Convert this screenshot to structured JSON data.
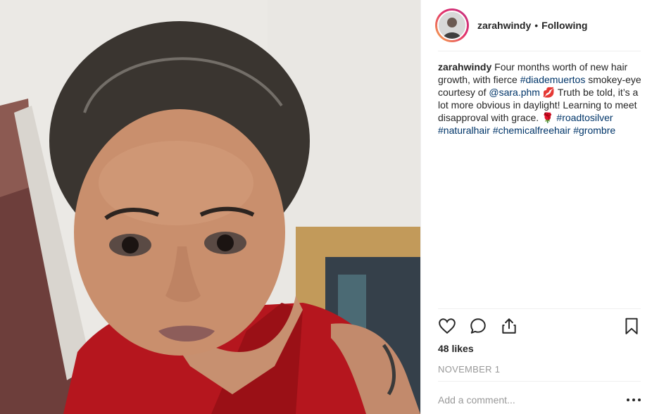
{
  "post": {
    "author": {
      "username": "zarahwindy",
      "follow_state": "Following",
      "separator": "•"
    },
    "caption": {
      "username": "zarahwindy",
      "segments": [
        {
          "type": "text",
          "value": " Four months worth of new hair growth, with fierce "
        },
        {
          "type": "link",
          "value": "#diademuertos"
        },
        {
          "type": "text",
          "value": " smokey-eye courtesy of "
        },
        {
          "type": "link",
          "value": "@sara.phm"
        },
        {
          "type": "text",
          "value": " 💋 Truth be told, it’s a lot more obvious in daylight! Learning to meet disapproval with grace. 🌹 "
        },
        {
          "type": "link",
          "value": "#roadtosilver"
        },
        {
          "type": "text",
          "value": " "
        },
        {
          "type": "link",
          "value": "#naturalhair"
        },
        {
          "type": "text",
          "value": " "
        },
        {
          "type": "link",
          "value": "#chemicalfreehair"
        },
        {
          "type": "text",
          "value": " "
        },
        {
          "type": "link",
          "value": "#grombre"
        }
      ]
    },
    "actions": {
      "like_icon": "heart-icon",
      "comment_icon": "comment-bubble-icon",
      "share_icon": "share-icon",
      "save_icon": "bookmark-icon"
    },
    "likes_text": "48 likes",
    "date_text": "NOVEMBER 1",
    "comment_placeholder": "Add a comment...",
    "more_icon": "more-options-icon"
  },
  "colors": {
    "link": "#003569",
    "muted": "#999999",
    "text": "#262626",
    "border": "#efefef"
  }
}
